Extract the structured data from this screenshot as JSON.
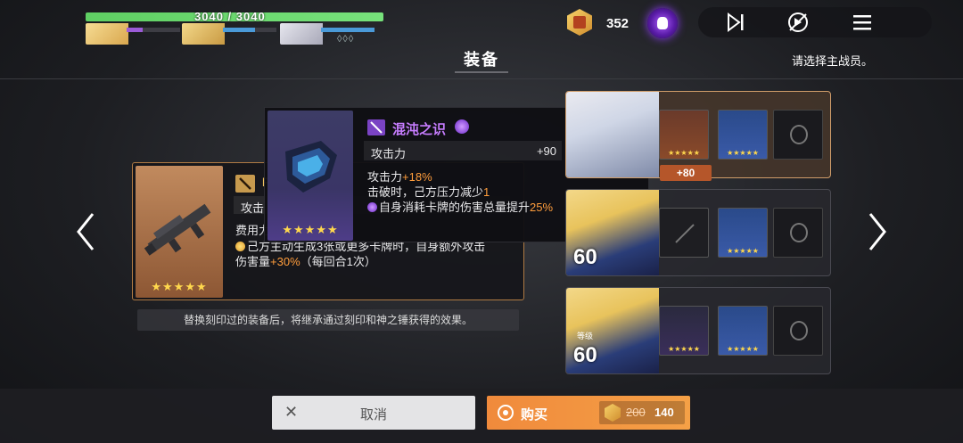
{
  "hud": {
    "hp_text": "3040 / 3040",
    "hp_fraction": 1.0,
    "currency_value": "352",
    "party": [
      {
        "name": "portrait-1",
        "color": "#f4cf7a",
        "bar_color": "#9b5bd8"
      },
      {
        "name": "portrait-2",
        "color": "#e9c86a",
        "bar_color": "#4a9ad8"
      },
      {
        "name": "portrait-3",
        "color": "#c9c9d2",
        "bar_color": "#4a9ad8"
      }
    ],
    "gems_text": "◊◊◊"
  },
  "screen": {
    "title": "装备",
    "hint": "请选择主战员。"
  },
  "left_card": {
    "name": "F",
    "stat_label": "攻击",
    "cost_line": "费用力",
    "effect_line1": "己方主动生成3张或更多卡牌时，自身额外攻击",
    "effect_line2_prefix": "伤害量",
    "effect_line2_value": "+30%",
    "effect_line2_suffix": "（每回合1次）",
    "stars": "★★★★★"
  },
  "footer_note": "替换刻印过的装备后，将继承通过刻印和神之锤获得的效果。",
  "tooltip": {
    "name": "混沌之识",
    "stat_label": "攻击力",
    "stat_value": "+90",
    "line1_prefix": "攻击力",
    "line1_value": "+18%",
    "line2_prefix": "击破时，己方压力减少",
    "line2_value": "1",
    "line3_prefix": "自身消耗卡牌的伤害总量提升",
    "line3_value": "25%",
    "stars": "★★★★★"
  },
  "members": [
    {
      "level": "",
      "level_label": "",
      "plus": "+80",
      "slot_stars": "★★★★★",
      "selected": true
    },
    {
      "level": "60",
      "level_label": "",
      "plus": "",
      "slot_stars": "★★★★★",
      "selected": false
    },
    {
      "level": "60",
      "level_label": "等级",
      "plus": "",
      "slot_stars": "★★★★★",
      "selected": false
    }
  ],
  "buttons": {
    "cancel_label": "取消",
    "buy_label": "购买",
    "old_price": "200",
    "new_price": "140"
  },
  "colors": {
    "accent_orange": "#f5a046",
    "rare_purple": "#c77dff",
    "hp_green": "#6fdc73"
  }
}
